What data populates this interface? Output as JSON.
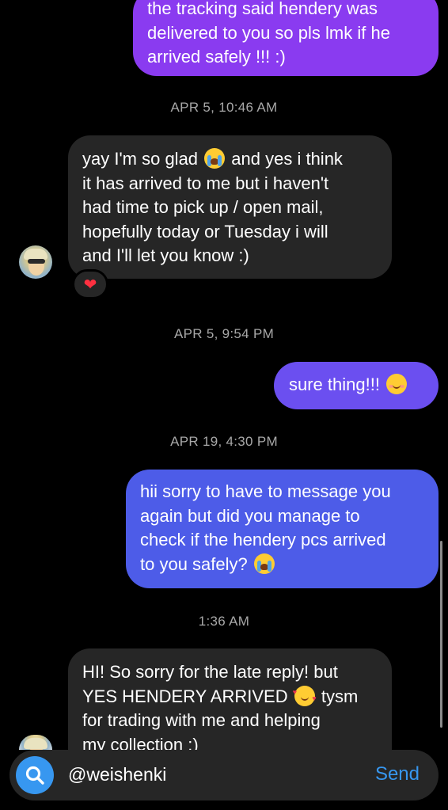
{
  "messages": [
    {
      "direction": "outgoing",
      "lines": [
        "the tracking said hendery was",
        "delivered to you so pls lmk if he",
        "arrived safely !!! :)"
      ]
    },
    {
      "direction": "incoming",
      "lines": [
        "yay I'm so glad",
        "and yes i think",
        "it has arrived to me but i haven't",
        "had time to pick up / open mail,",
        "hopefully today or Tuesday i will",
        "and I'll let you know :)"
      ],
      "reaction": "❤"
    },
    {
      "direction": "outgoing",
      "lines": [
        "sure thing!!!"
      ]
    },
    {
      "direction": "outgoing",
      "lines": [
        "hii sorry to have to message you",
        "again but did you manage to",
        "check if the hendery pcs arrived",
        "to you safely?"
      ]
    },
    {
      "direction": "incoming",
      "lines": [
        "HI! So sorry for the late reply! but",
        "YES HENDERY ARRIVED",
        "tysm",
        "for trading with me and helping",
        "my collection :)"
      ]
    }
  ],
  "timestamps": [
    "APR 5, 10:46 AM",
    "APR 5, 9:54 PM",
    "APR 19, 4:30 PM",
    "1:36 AM"
  ],
  "composer": {
    "value": "@weishenki",
    "send_label": "Send"
  },
  "colors": {
    "outgoing_top": "#8a3bf0",
    "outgoing_mid": "#6b4ff0",
    "outgoing_bottom": "#4d5ce8",
    "incoming": "#262626",
    "accent": "#3797f0"
  },
  "icons": {
    "composer_left": "search-icon",
    "emoji_1": "loudly-crying-face",
    "emoji_2": "smiling-face",
    "emoji_3": "smiling-face-with-hearts"
  }
}
